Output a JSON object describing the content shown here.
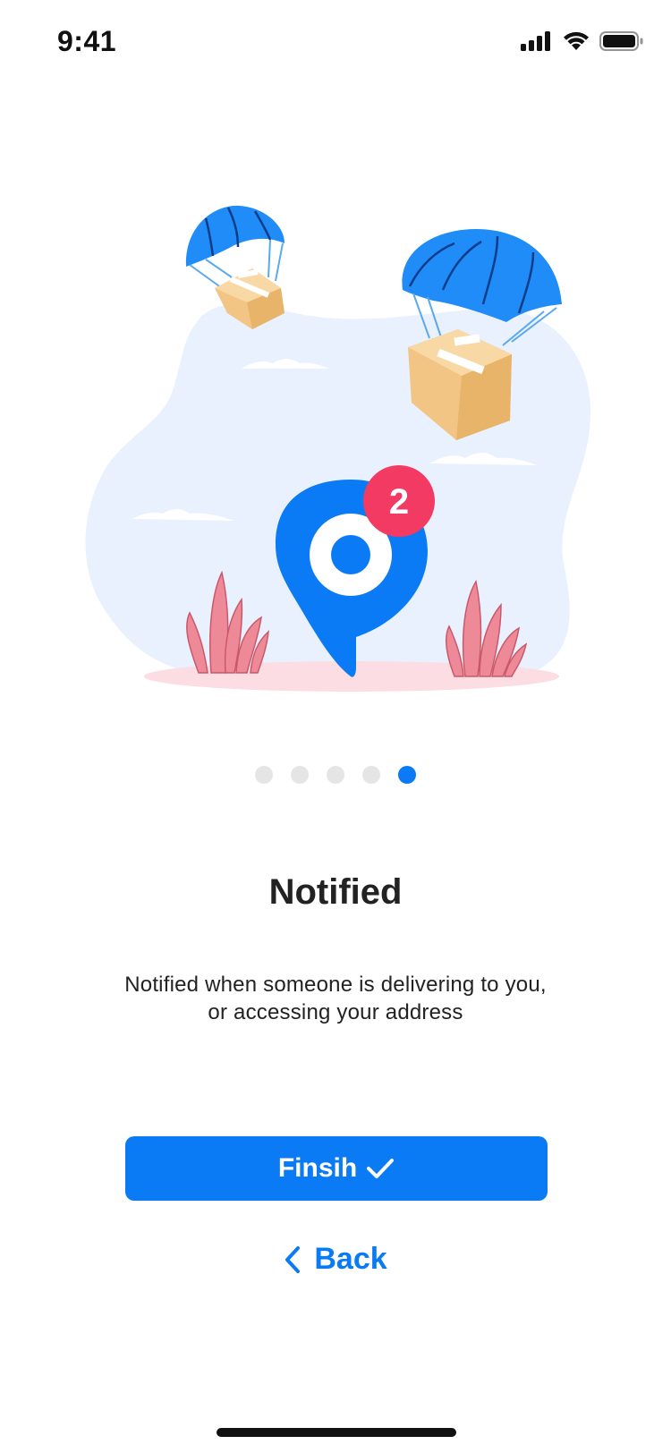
{
  "status_bar": {
    "time": "9:41",
    "icons": [
      "cellular-signal-icon",
      "wifi-icon",
      "battery-icon"
    ]
  },
  "illustration": {
    "badge_count": "2",
    "icons": [
      "parachute-box-icon",
      "location-pin-icon",
      "notification-badge-icon",
      "plant-icon",
      "cloud-icon"
    ]
  },
  "pager": {
    "total": 5,
    "active_index": 4
  },
  "onboarding": {
    "title": "Notified",
    "description_line1": "Notified when someone is delivering to you,",
    "description_line2": "or accessing your address"
  },
  "actions": {
    "finish_label": "Finsih",
    "back_label": "Back"
  },
  "colors": {
    "primary": "#0a7bf5",
    "badge": "#f23a62",
    "background_blob": "#e8f1fd",
    "plant": "#ee8a98",
    "box": "#f2c585",
    "dot_inactive": "#e5e5e5"
  }
}
